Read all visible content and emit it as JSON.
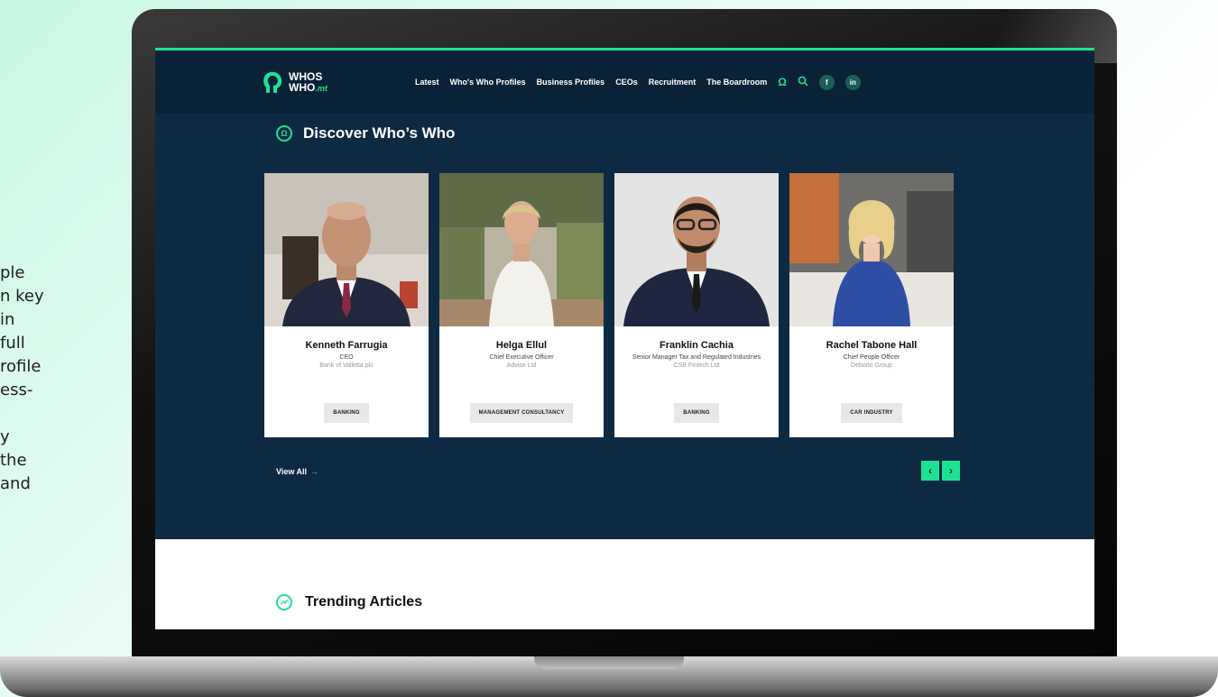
{
  "side_text": [
    "ple",
    "n key",
    "in",
    "full",
    "rofile",
    "ess-",
    "",
    "y",
    "the",
    "and"
  ],
  "nav": {
    "logo_line1": "WHOS",
    "logo_line2": "WHO",
    "logo_suffix": ".mt",
    "items": [
      "Latest",
      "Who's Who Profiles",
      "Business Profiles",
      "CEOs",
      "Recruitment",
      "The Boardroom"
    ],
    "facebook": "f",
    "linkedin": "in"
  },
  "discover": {
    "title": "Discover Who’s Who"
  },
  "cards": [
    {
      "name": "Kenneth Farrugia",
      "role": "CEO",
      "company": "Bank of Valletta plc",
      "tag": "BANKING"
    },
    {
      "name": "Helga Ellul",
      "role": "Chief Executive Officer",
      "company": "Advise Ltd",
      "tag": "MANAGEMENT CONSULTANCY"
    },
    {
      "name": "Franklin Cachia",
      "role": "Senior Manager Tax and Regulated Industries",
      "company": "CSB Fintech Ltd",
      "tag": "BANKING"
    },
    {
      "name": "Rachel Tabone Hall",
      "role": "Chief People Officer",
      "company": "Debono Group",
      "tag": "CAR INDUSTRY"
    }
  ],
  "view_all": "View All",
  "pager": {
    "prev": "‹",
    "next": "›"
  },
  "trending": {
    "title": "Trending Articles"
  },
  "colors": {
    "accent": "#1de294",
    "navy": "#0e2a43",
    "header": "#0a2237"
  }
}
